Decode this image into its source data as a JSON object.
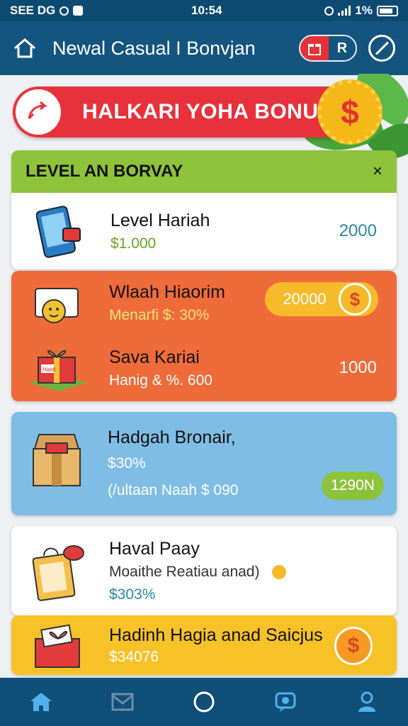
{
  "status_bar": {
    "left_text": "SEE DG",
    "center_time": "10:54",
    "battery_text": "1%"
  },
  "header": {
    "title": "Newal Casual I Bonvjan",
    "profile_letter": "R",
    "icons": [
      "home-outline-icon",
      "gift-icon",
      "user-icon",
      "compass-icon"
    ]
  },
  "banner": {
    "text": "HALKARI YOHA BONUS",
    "coin_symbol": "$",
    "color": "#e8323b"
  },
  "level_card": {
    "title": "LEVEL AN BORVAY",
    "close": "×",
    "item": {
      "title": "Level Hariah",
      "sub": "$1.000",
      "amount": "2000"
    }
  },
  "orange_card": {
    "items": [
      {
        "title": "Wlaah Hiaorim",
        "sub": "Menarfi $: 30%",
        "amount": "20000"
      },
      {
        "title": "Sava Kariai",
        "sub": "Hanig & %. 600",
        "amount": "1000",
        "gift_label": "Hahfi"
      }
    ]
  },
  "blue_card": {
    "title": "Hadgah Bronair,",
    "sub": "$30%",
    "line": "(/ultaan Naah $ 090",
    "pill": "1290N"
  },
  "white_card": {
    "title": "Haval Paay",
    "sub": "Moaithe Reatiau anad)",
    "pct": "$303%"
  },
  "yellow_card": {
    "title": "Hadinh Hagia anad Saicjus",
    "sub": "$34076",
    "coin_symbol": "$"
  },
  "bottom_nav": [
    "home-icon",
    "mail-icon",
    "circle-icon",
    "chat-icon",
    "profile-icon"
  ],
  "colors": {
    "header": "#14557f",
    "green": "#8fc23b",
    "orange": "#ef6b3a",
    "blue": "#7fbde4",
    "yellow": "#f7c128"
  }
}
